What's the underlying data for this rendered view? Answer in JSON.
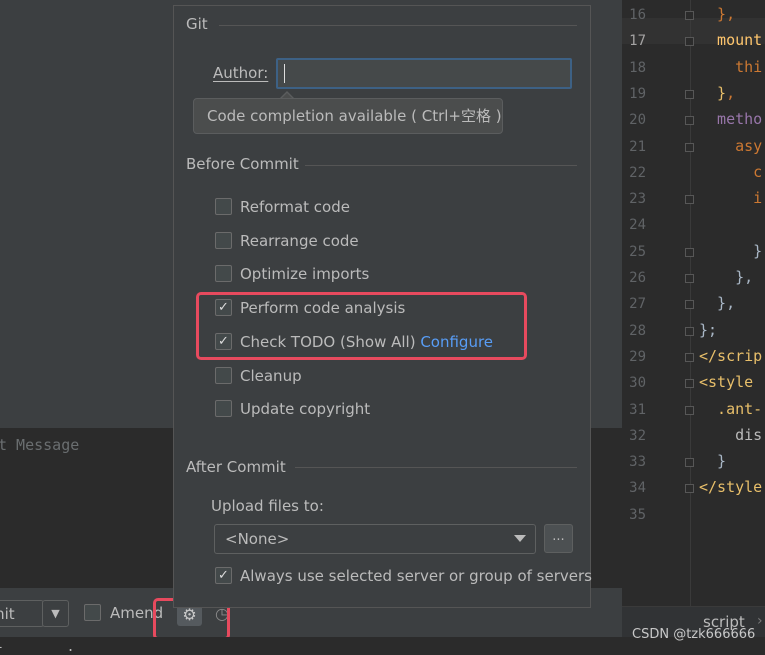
{
  "commit_panel": {
    "message_placeholder": "t Message",
    "commit_button_label": "mit",
    "commit_dropdown_glyph": "▼",
    "amend_label": "Amend",
    "settings_icon": "gear-icon",
    "settings_glyph": "⚙",
    "history_icon": "clock-icon",
    "history_glyph": "◷",
    "bottom_text": "-       ."
  },
  "popup": {
    "git_title": "Git",
    "author_label": "Author:",
    "author_value": "",
    "tooltip": "Code completion available ( Ctrl+空格 )",
    "before_commit_title": "Before Commit",
    "checkboxes": [
      {
        "label": "Reformat code",
        "checked": false
      },
      {
        "label": "Rearrange code",
        "checked": false
      },
      {
        "label": "Optimize imports",
        "checked": false
      },
      {
        "label": "Perform code analysis",
        "checked": true
      },
      {
        "label": "Check TODO (Show All)",
        "link": "Configure",
        "checked": true
      },
      {
        "label": "Cleanup",
        "checked": false
      },
      {
        "label": "Update copyright",
        "checked": false
      }
    ],
    "check_glyph": "✓",
    "after_commit_title": "After Commit",
    "upload_label": "Upload files to:",
    "upload_value": "<None>",
    "browse_label": "...",
    "always_use_label": "Always use selected server or group of servers",
    "always_use_checked": true
  },
  "editor": {
    "line_numbers": [
      "16",
      "17",
      "18",
      "19",
      "20",
      "21",
      "22",
      "23",
      "24",
      "25",
      "26",
      "27",
      "28",
      "29",
      "30",
      "31",
      "32",
      "33",
      "34",
      "35"
    ],
    "current_line": "17",
    "lines": [
      [
        {
          "t": "  },",
          "c": "#cc7832"
        }
      ],
      [
        {
          "t": "  mount",
          "c": "#ffc66d"
        }
      ],
      [
        {
          "t": "    thi",
          "c": "#cc7832"
        }
      ],
      [
        {
          "t": "  }",
          "c": "#e8bf6a"
        },
        {
          "t": ",",
          "c": "#cc7832"
        }
      ],
      [
        {
          "t": "  metho",
          "c": "#9876aa"
        }
      ],
      [
        {
          "t": "    asy",
          "c": "#cc7832"
        }
      ],
      [
        {
          "t": "      c",
          "c": "#cc7832"
        }
      ],
      [
        {
          "t": "      i",
          "c": "#cc7832"
        }
      ],
      [
        {
          "t": "",
          "c": "#a9b7c6"
        }
      ],
      [
        {
          "t": "      }",
          "c": "#a9b7c6"
        }
      ],
      [
        {
          "t": "    },",
          "c": "#a9b7c6"
        }
      ],
      [
        {
          "t": "  },",
          "c": "#a9b7c6"
        }
      ],
      [
        {
          "t": "};",
          "c": "#a9b7c6"
        }
      ],
      [
        {
          "t": "</scrip",
          "c": "#e8bf6a"
        }
      ],
      [
        {
          "t": "<style ",
          "c": "#e8bf6a"
        }
      ],
      [
        {
          "t": "  .ant-",
          "c": "#e8bf6a"
        }
      ],
      [
        {
          "t": "    dis",
          "c": "#bababa"
        }
      ],
      [
        {
          "t": "  }",
          "c": "#a9b7c6"
        }
      ],
      [
        {
          "t": "</style",
          "c": "#e8bf6a"
        }
      ],
      [
        {
          "t": "",
          "c": "#a9b7c6"
        }
      ]
    ],
    "breadcrumb_tab": "script",
    "breadcrumb_chevron": "›"
  },
  "watermark": "CSDN @tzk666666",
  "colors": {
    "highlight_red": "#e74a5e",
    "link_blue": "#589df6",
    "focus_border": "#3d6185"
  }
}
